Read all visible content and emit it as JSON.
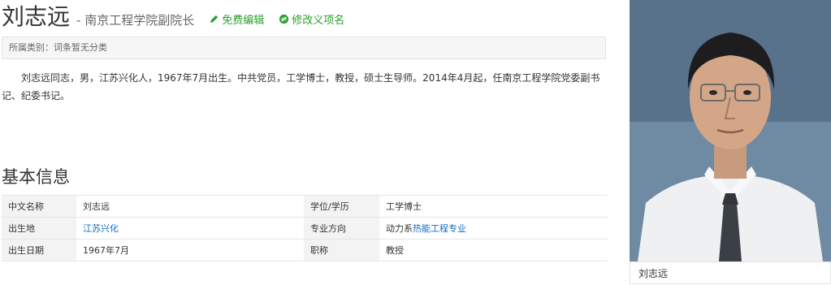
{
  "header": {
    "title": "刘志远",
    "subtitle": "- 南京工程学院副院长",
    "edit_label": "免费编辑",
    "modify_label": "修改义项名"
  },
  "category": {
    "text": "所属类别：词条暂无分类"
  },
  "summary": {
    "text": "刘志远同志，男，江苏兴化人，1967年7月出生。中共党员，工学博士，教授，硕士生导师。2014年4月起，任南京工程学院党委副书记、纪委书记。"
  },
  "basic_info": {
    "title": "基本信息",
    "rows": [
      {
        "k1": "中文名称",
        "v1": "刘志远",
        "k2": "学位/学历",
        "v2": "工学博士"
      },
      {
        "k1": "出生地",
        "v1": "江苏兴化",
        "k2": "专业方向",
        "v2_prefix": "动力系",
        "v2_link": "热能工程专业"
      },
      {
        "k1": "出生日期",
        "v1": "1967年7月",
        "k2": "职称",
        "v2": "教授"
      }
    ]
  },
  "photo": {
    "caption": "刘志远"
  },
  "colors": {
    "accent_green": "#2b9e2b",
    "link_blue": "#136ec2"
  },
  "icons": {
    "edit": "pencil-icon",
    "modify": "swap-icon"
  }
}
